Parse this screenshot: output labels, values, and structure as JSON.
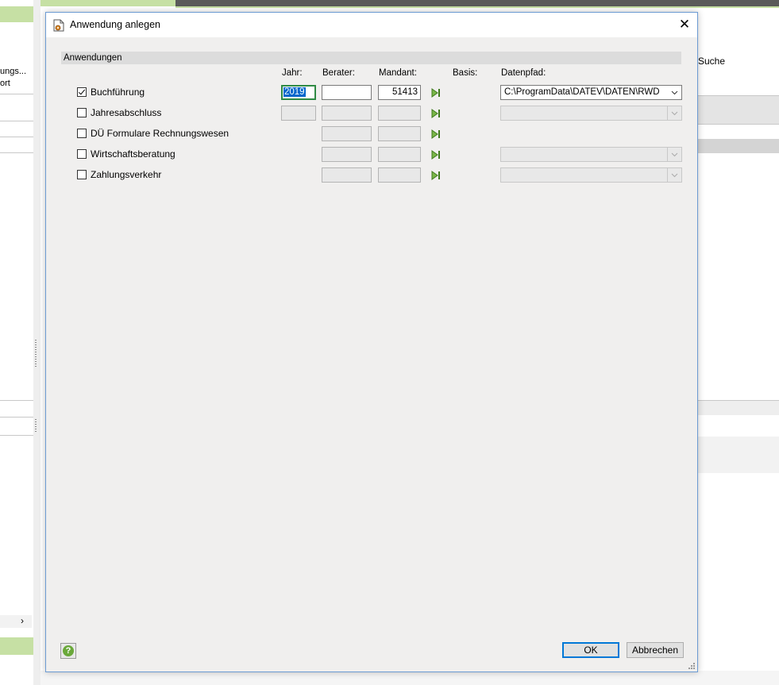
{
  "background": {
    "left_items": [
      "ungs...",
      "ort"
    ],
    "right_label": "Suche"
  },
  "dialog": {
    "title": "Anwendung anlegen",
    "close_glyph": "✕",
    "section_header": "Anwendungen",
    "columns": {
      "jahr": "Jahr:",
      "berater": "Berater:",
      "mandant": "Mandant:",
      "basis": "Basis:",
      "datenpfad": "Datenpfad:"
    },
    "rows": [
      {
        "label": "Buchführung",
        "checked": true,
        "jahr": "2019",
        "berater": "",
        "mandant": "51413",
        "datenpfad": "C:\\ProgramData\\DATEV\\DATEN\\RWD"
      },
      {
        "label": "Jahresabschluss",
        "checked": false,
        "jahr": "",
        "berater": "",
        "mandant": "",
        "datenpfad": ""
      },
      {
        "label": "DÜ Formulare Rechnungswesen",
        "checked": false,
        "berater": "",
        "mandant": ""
      },
      {
        "label": "Wirtschaftsberatung",
        "checked": false,
        "berater": "",
        "mandant": "",
        "datenpfad": ""
      },
      {
        "label": "Zahlungsverkehr",
        "checked": false,
        "berater": "",
        "mandant": "",
        "datenpfad": ""
      }
    ],
    "buttons": {
      "ok": "OK",
      "cancel": "Abbrechen",
      "help": "?"
    }
  },
  "icons": {
    "title": "document-gear-icon",
    "next": "play-next-icon",
    "help": "help-icon",
    "dropdown": "chevron-down-icon"
  },
  "colors": {
    "accent_green": "#c6e0a4",
    "focus_border": "#2f8a44",
    "selection": "#0066cc",
    "default_button_border": "#0078d7"
  }
}
